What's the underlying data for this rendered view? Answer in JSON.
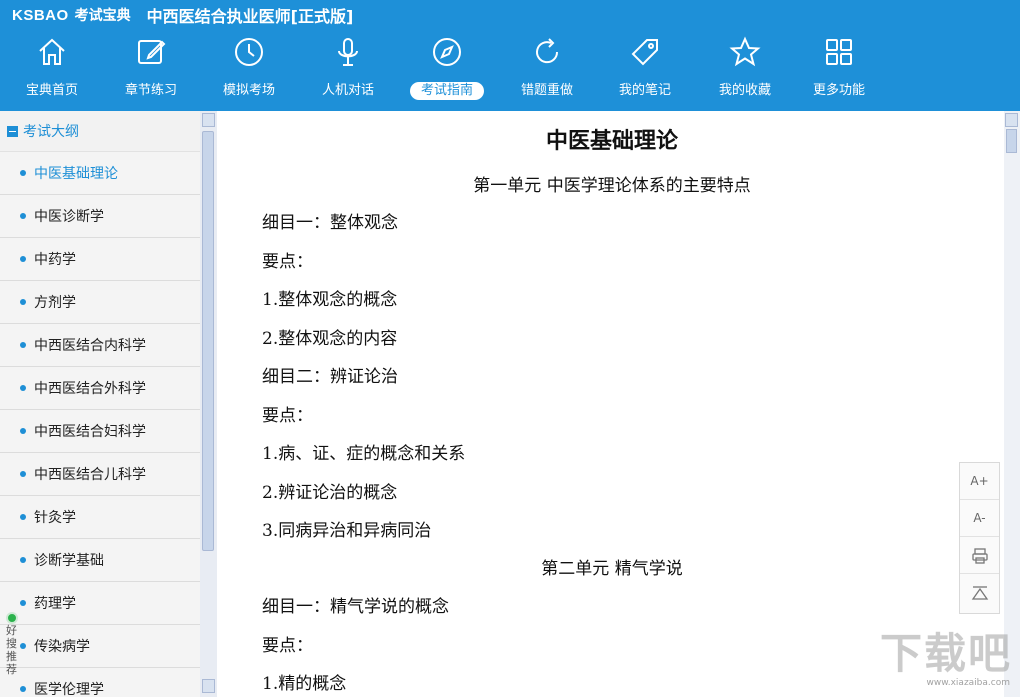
{
  "header": {
    "brand": "KSBAO",
    "brand_sub": "考试宝典",
    "app_title": "中西医结合执业医师[正式版]"
  },
  "toolbar": [
    {
      "label": "宝典首页",
      "icon": "home-icon"
    },
    {
      "label": "章节练习",
      "icon": "edit-icon"
    },
    {
      "label": "模拟考场",
      "icon": "clock-icon"
    },
    {
      "label": "人机对话",
      "icon": "microphone-icon"
    },
    {
      "label": "考试指南",
      "icon": "compass-icon",
      "active": true
    },
    {
      "label": "错题重做",
      "icon": "refresh-icon"
    },
    {
      "label": "我的笔记",
      "icon": "tag-icon"
    },
    {
      "label": "我的收藏",
      "icon": "star-icon"
    },
    {
      "label": "更多功能",
      "icon": "grid-icon"
    }
  ],
  "sidebar": {
    "header": "考试大纲",
    "items": [
      {
        "label": "中医基础理论",
        "active": true
      },
      {
        "label": "中医诊断学"
      },
      {
        "label": "中药学"
      },
      {
        "label": "方剂学"
      },
      {
        "label": "中西医结合内科学"
      },
      {
        "label": "中西医结合外科学"
      },
      {
        "label": "中西医结合妇科学"
      },
      {
        "label": "中西医结合儿科学"
      },
      {
        "label": "针灸学"
      },
      {
        "label": "诊断学基础"
      },
      {
        "label": "药理学"
      },
      {
        "label": "传染病学"
      },
      {
        "label": "医学伦理学"
      }
    ],
    "badge": "好搜推荐"
  },
  "content": {
    "title": "中医基础理论",
    "lines": [
      "第一单元  中医学理论体系的主要特点",
      "细目一：整体观念",
      "要点：",
      "1.整体观念的概念",
      "2.整体观念的内容",
      "细目二：辨证论治",
      "要点：",
      "1.病、证、症的概念和关系",
      "2.辨证论治的概念",
      "3.同病异治和异病同治",
      "第二单元  精气学说",
      "细目一：精气学说的概念",
      "要点：",
      "1.精的概念"
    ]
  },
  "float_tools": {
    "font_up": "A+",
    "font_down": "A-"
  },
  "watermark": {
    "text": "下载吧",
    "url": "www.xiazaiba.com"
  },
  "colors": {
    "header_bg": "#1e90d8",
    "accent": "#1e8fd6"
  }
}
